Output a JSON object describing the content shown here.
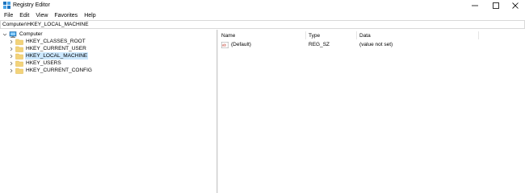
{
  "window": {
    "title": "Registry Editor"
  },
  "menu": [
    "File",
    "Edit",
    "View",
    "Favorites",
    "Help"
  ],
  "address": {
    "value": "Computer\\HKEY_LOCAL_MACHINE"
  },
  "tree": {
    "root": {
      "label": "Computer",
      "expanded": true
    },
    "children": [
      {
        "label": "HKEY_CLASSES_ROOT",
        "selected": false
      },
      {
        "label": "HKEY_CURRENT_USER",
        "selected": false
      },
      {
        "label": "HKEY_LOCAL_MACHINE",
        "selected": true
      },
      {
        "label": "HKEY_USERS",
        "selected": false
      },
      {
        "label": "HKEY_CURRENT_CONFIG",
        "selected": false
      }
    ]
  },
  "values": {
    "columns": [
      "Name",
      "Type",
      "Data"
    ],
    "rows": [
      {
        "name": "(Default)",
        "type": "REG_SZ",
        "data": "(value not set)"
      }
    ]
  },
  "colors": {
    "selection": "#cce8ff",
    "folder": "#f3d37a",
    "folder_dark": "#e0b64a",
    "computer_icon": "#2a8fd6"
  }
}
